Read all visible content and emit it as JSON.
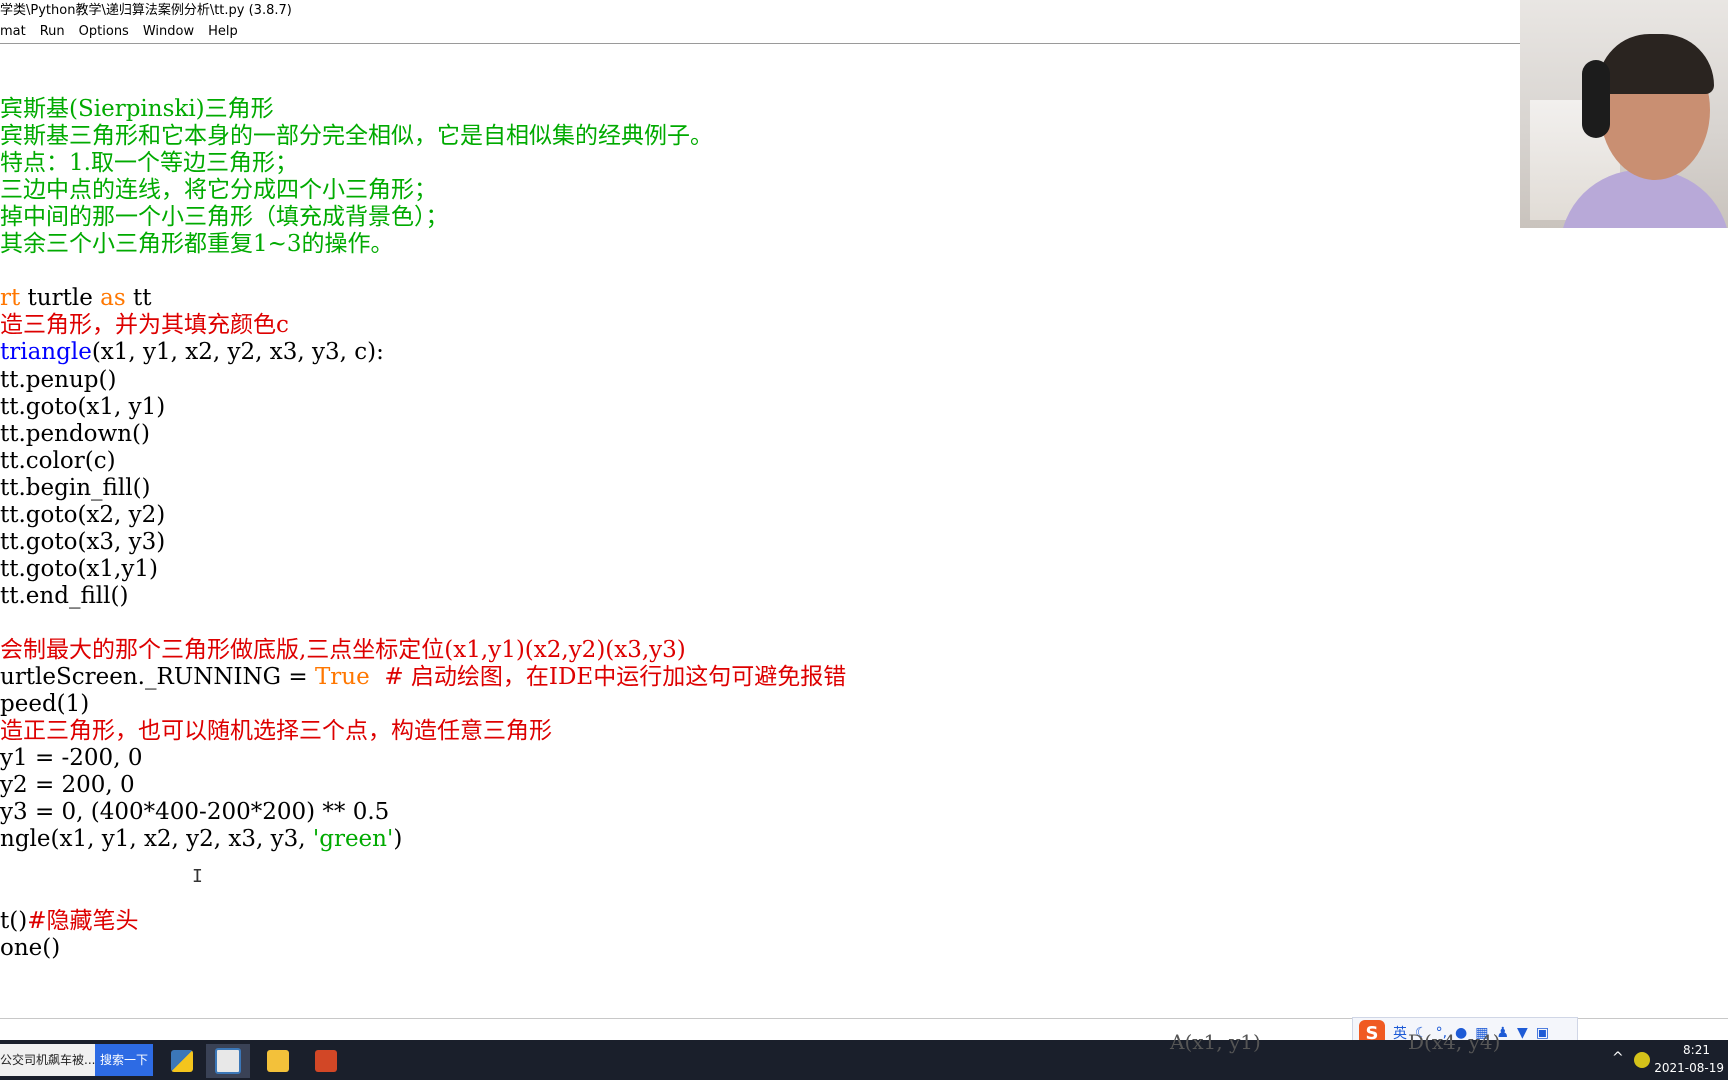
{
  "window": {
    "title": "学类\\Python教学\\递归算法案例分析\\tt.py (3.8.7)"
  },
  "menu": [
    "mat",
    "Run",
    "Options",
    "Window",
    "Help"
  ],
  "code_lines": [
    {
      "segments": [
        {
          "t": "宾斯基(Sierpinski)三角形",
          "c": "c-string"
        }
      ]
    },
    {
      "segments": [
        {
          "t": "宾斯基三角形和它本身的一部分完全相似，它是自相似集的经典例子。",
          "c": "c-string"
        }
      ]
    },
    {
      "segments": [
        {
          "t": "特点：1.取一个等边三角形；",
          "c": "c-string"
        }
      ]
    },
    {
      "segments": [
        {
          "t": "三边中点的连线，将它分成四个小三角形；",
          "c": "c-string"
        }
      ]
    },
    {
      "segments": [
        {
          "t": "掉中间的那一个小三角形（填充成背景色）；",
          "c": "c-string"
        }
      ]
    },
    {
      "segments": [
        {
          "t": "其余三个小三角形都重复1~3的操作。",
          "c": "c-string"
        }
      ]
    },
    {
      "segments": []
    },
    {
      "segments": [
        {
          "t": "rt",
          "c": "c-kw"
        },
        {
          "t": " turtle ",
          "c": "c-normal"
        },
        {
          "t": "as",
          "c": "c-kw"
        },
        {
          "t": " tt",
          "c": "c-normal"
        }
      ]
    },
    {
      "segments": [
        {
          "t": "造三角形，并为其填充颜色c",
          "c": "c-comment"
        }
      ]
    },
    {
      "segments": [
        {
          "t": "triangle",
          "c": "c-def"
        },
        {
          "t": "(x1, y1, x2, y2, x3, y3, c):",
          "c": "c-normal"
        }
      ]
    },
    {
      "segments": [
        {
          "t": "tt.penup()",
          "c": "c-normal"
        }
      ]
    },
    {
      "segments": [
        {
          "t": "tt.goto(x1, y1)",
          "c": "c-normal"
        }
      ]
    },
    {
      "segments": [
        {
          "t": "tt.pendown()",
          "c": "c-normal"
        }
      ]
    },
    {
      "segments": [
        {
          "t": "tt.color(c)",
          "c": "c-normal"
        }
      ]
    },
    {
      "segments": [
        {
          "t": "tt.begin_fill()",
          "c": "c-normal"
        }
      ]
    },
    {
      "segments": [
        {
          "t": "tt.goto(x2, y2)",
          "c": "c-normal"
        }
      ]
    },
    {
      "segments": [
        {
          "t": "tt.goto(x3, y3)",
          "c": "c-normal"
        }
      ]
    },
    {
      "segments": [
        {
          "t": "tt.goto(x1,y1)",
          "c": "c-normal"
        }
      ]
    },
    {
      "segments": [
        {
          "t": "tt.end_fill()",
          "c": "c-normal"
        }
      ]
    },
    {
      "segments": []
    },
    {
      "segments": [
        {
          "t": "会制最大的那个三角形做底版,三点坐标定位(x1,y1)(x2,y2)(x3,y3)",
          "c": "c-comment"
        }
      ]
    },
    {
      "segments": [
        {
          "t": "urtleScreen._RUNNING = ",
          "c": "c-normal"
        },
        {
          "t": "True",
          "c": "c-kw"
        },
        {
          "t": "  # 启动绘图，在IDE中运行加这句可避免报错",
          "c": "c-comment"
        }
      ]
    },
    {
      "segments": [
        {
          "t": "peed(1)",
          "c": "c-normal"
        }
      ]
    },
    {
      "segments": [
        {
          "t": "造正三角形，也可以随机选择三个点，构造任意三角形",
          "c": "c-comment"
        }
      ]
    },
    {
      "segments": [
        {
          "t": "y1 = -200, 0",
          "c": "c-normal"
        }
      ]
    },
    {
      "segments": [
        {
          "t": "y2 = 200, 0",
          "c": "c-normal"
        }
      ]
    },
    {
      "segments": [
        {
          "t": "y3 = 0, (400*400-200*200) ** 0.5",
          "c": "c-normal"
        }
      ]
    },
    {
      "segments": [
        {
          "t": "ngle(x1, y1, x2, y2, x3, y3, ",
          "c": "c-normal"
        },
        {
          "t": "'green'",
          "c": "c-string"
        },
        {
          "t": ")",
          "c": "c-normal"
        }
      ]
    },
    {
      "segments": []
    },
    {
      "segments": []
    },
    {
      "segments": [
        {
          "t": "t()",
          "c": "c-normal"
        },
        {
          "t": "#隐藏笔头",
          "c": "c-comment"
        }
      ]
    },
    {
      "segments": [
        {
          "t": "one()",
          "c": "c-normal"
        }
      ]
    }
  ],
  "cursor_glyph": "I",
  "ime": {
    "logo": "S",
    "mode": "英"
  },
  "taskbar": {
    "news_text": "公交司机飙车被...",
    "search_label": "搜索一下",
    "behind_left": "A(x1, y1)",
    "behind_right": "D(x4, y4)",
    "time": "8:21",
    "date": "2021-08-19"
  }
}
